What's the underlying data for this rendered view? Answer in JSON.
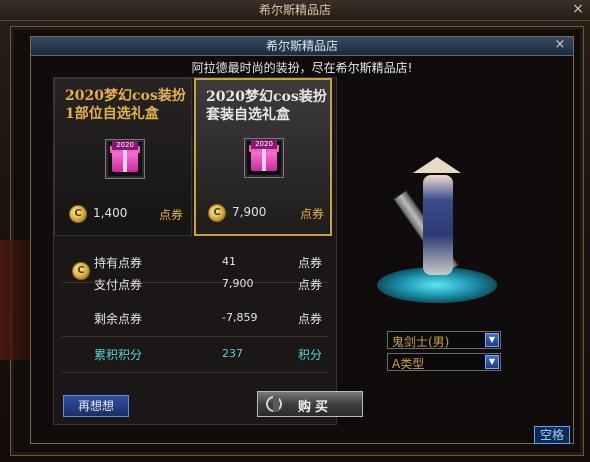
{
  "outer_window": {
    "title": "希尔斯精品店",
    "close": "×"
  },
  "dialog": {
    "title": "希尔斯精品店",
    "close": "×",
    "subtitle": "阿拉德最时尚的装扮，尽在希尔斯精品店!"
  },
  "items": [
    {
      "name": "2020梦幻cos装扮1部位自选礼盒",
      "badge": "2020",
      "price": "1,400",
      "unit": "点券",
      "selected": false
    },
    {
      "name": "2020梦幻cos装扮套装自选礼盒",
      "badge": "2020",
      "price": "7,900",
      "unit": "点券",
      "selected": true
    }
  ],
  "summary": {
    "coin_glyph": "C",
    "held": {
      "label": "持有点券",
      "value": "41",
      "unit": "点券"
    },
    "pay": {
      "label": "支付点券",
      "value": "7,900",
      "unit": "点券"
    },
    "remaining": {
      "label": "剩余点券",
      "value": "-7,859",
      "unit": "点券"
    },
    "points": {
      "label": "累积积分",
      "value": "237",
      "unit": "积分"
    }
  },
  "character": {
    "class_select": "鬼剑士(男)",
    "type_select": "A类型"
  },
  "buttons": {
    "rethink": "再想想",
    "buy": "购买",
    "space": "空格"
  },
  "colors": {
    "gold": "#e3b14a",
    "teal": "#55d2d4",
    "selected_border": "#c9a142"
  }
}
